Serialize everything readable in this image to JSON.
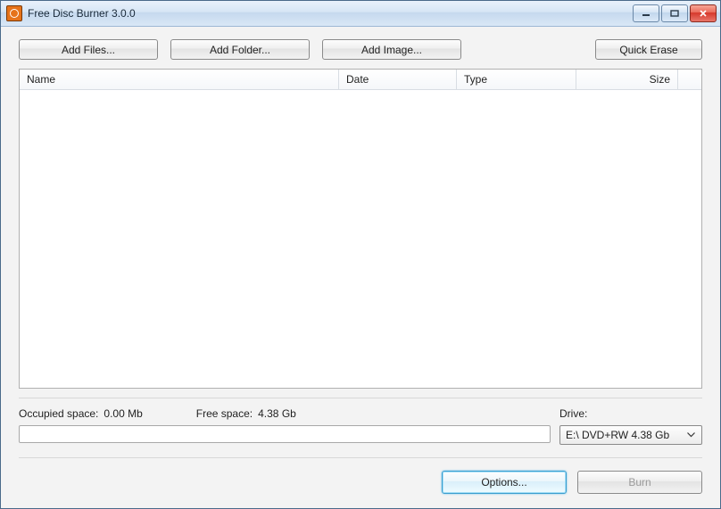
{
  "window": {
    "title": "Free Disc Burner  3.0.0"
  },
  "toolbar": {
    "add_files": "Add Files...",
    "add_folder": "Add Folder...",
    "add_image": "Add Image...",
    "quick_erase": "Quick Erase"
  },
  "listview": {
    "columns": {
      "name": "Name",
      "date": "Date",
      "type": "Type",
      "size": "Size"
    },
    "rows": []
  },
  "status": {
    "occupied_label": "Occupied space:",
    "occupied_value": "0.00 Mb",
    "free_label": "Free space:",
    "free_value": "4.38 Gb"
  },
  "drive": {
    "label": "Drive:",
    "selected": "E:\\ DVD+RW 4.38 Gb"
  },
  "bottom": {
    "options": "Options...",
    "burn": "Burn"
  }
}
